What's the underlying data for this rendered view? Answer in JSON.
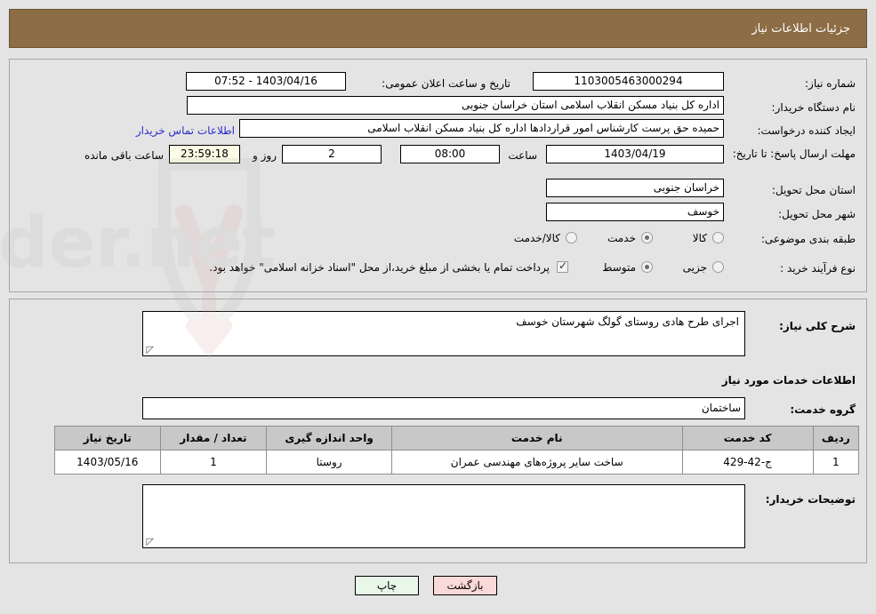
{
  "header": {
    "title": "جزئیات اطلاعات نیاز"
  },
  "top_panel": {
    "need_number_label": "شماره نیاز:",
    "need_number_value": "1103005463000294",
    "announce_label": "تاریخ و ساعت اعلان عمومی:",
    "announce_value": "1403/04/16 - 07:52",
    "buyer_org_label": "نام دستگاه خریدار:",
    "buyer_org_value": "اداره کل بنیاد مسکن انقلاب اسلامی استان خراسان جنوبی",
    "creator_label": "ایجاد کننده درخواست:",
    "creator_value": "حمیده حق پرست کارشناس امور قراردادها اداره کل بنیاد مسکن انقلاب اسلامی",
    "contact_link": "اطلاعات تماس خریدار",
    "deadline_label": "مهلت ارسال پاسخ: تا تاریخ:",
    "deadline_date": "1403/04/19",
    "hour_label": "ساعت",
    "deadline_time": "08:00",
    "days_value": "2",
    "days_word": "روز و",
    "countdown_value": "23:59:18",
    "remaining_word": "ساعت باقی مانده",
    "province_label": "استان محل تحویل:",
    "province_value": "خراسان جنوبی",
    "city_label": "شهر محل تحویل:",
    "city_value": "خوسف",
    "category_label": "طبقه بندی موضوعی:",
    "category_options": [
      {
        "label": "کالا",
        "selected": false
      },
      {
        "label": "خدمت",
        "selected": true
      },
      {
        "label": "کالا/خدمت",
        "selected": false
      }
    ],
    "process_label": "نوع فرآیند خرید :",
    "process_options": [
      {
        "label": "جزیی",
        "selected": false
      },
      {
        "label": "متوسط",
        "selected": true
      }
    ],
    "treasury_checkbox_checked": true,
    "treasury_text": "پرداخت تمام یا بخشی از مبلغ خرید،از محل \"اسناد خزانه اسلامی\" خواهد بود."
  },
  "mid_panel": {
    "general_desc_label": "شرح کلی نیاز:",
    "general_desc_value": "اجرای طرح هادی روستای گولگ شهرستان خوسف",
    "services_section_title": "اطلاعات خدمات مورد نیاز",
    "service_group_label": "گروه خدمت:",
    "service_group_value": "ساختمان",
    "buyer_notes_label": "توضیحات خریدار:",
    "buyer_notes_value": ""
  },
  "table": {
    "columns": [
      "ردیف",
      "کد خدمت",
      "نام خدمت",
      "واحد اندازه گیری",
      "تعداد / مقدار",
      "تاریخ نیاز"
    ],
    "rows": [
      {
        "row": "1",
        "code": "ج-42-429",
        "name": "ساخت سایر پروژه‌های مهندسی عمران",
        "unit": "روستا",
        "qty": "1",
        "date": "1403/05/16"
      }
    ]
  },
  "footer": {
    "print_label": "چاپ",
    "back_label": "بازگشت"
  },
  "colors": {
    "header_bar": "#8d6d45",
    "page_background": "#e4e4e4",
    "panel_border": "#a6a6a6",
    "link": "#2b2bcc",
    "timer_background": "#fbfbe6",
    "table_header": "#c8c8c8",
    "print_button": "#e9f7e9",
    "back_button": "#fbd9d9"
  },
  "watermark": {
    "text": "AriaTender.net"
  }
}
